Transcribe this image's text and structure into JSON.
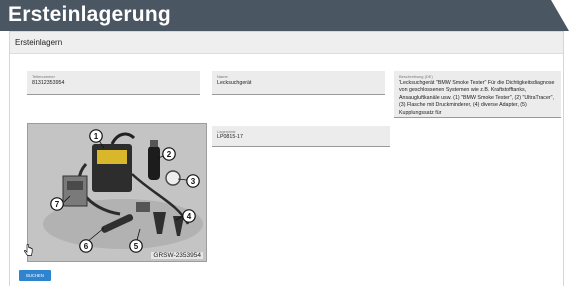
{
  "banner": {
    "title": "Ersteinlagerung"
  },
  "panel": {
    "title": "Ersteinlagern"
  },
  "fields": {
    "teilenummer": {
      "label": "Teilenummer",
      "value": "81312353954"
    },
    "name": {
      "label": "Name",
      "value": "Lecksuchgerät"
    },
    "beschreibung": {
      "label": "Beschreibung (DE)",
      "value": "'Lecksuchgerät \"BMW Smoke Tester\" Für die Dichtigkeitsdiagnose von geschlossenen Systemen wie z.B. Kraftstofftanks, Ansaugluftkanäle usw.  (1) \"BMW Smoke Tester\", (2) \"UltraTracer\", (3) Flasche mit Druckminderer, (4) diverse Adapter, (5) Kupplungssatz für"
    },
    "lagerplatz": {
      "label": "Lagerplatz",
      "value": "LP0815-17"
    }
  },
  "photo": {
    "code": "GRSW-2353954",
    "callouts": [
      "1",
      "2",
      "3",
      "4",
      "5",
      "6",
      "7"
    ]
  },
  "actions": {
    "submit_label": "BUCHEN"
  }
}
